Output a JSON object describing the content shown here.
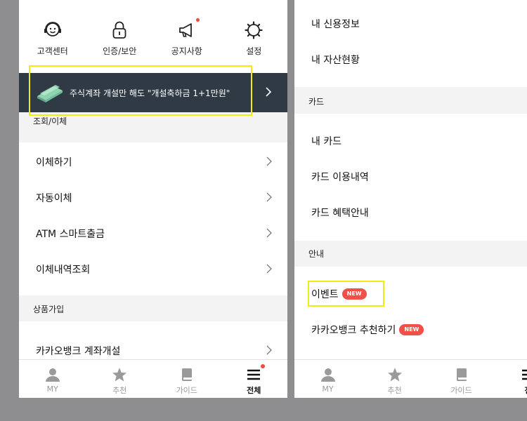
{
  "left_screen": {
    "quick_menu": [
      {
        "label": "고객센터",
        "icon": "headset-icon"
      },
      {
        "label": "인증/보안",
        "icon": "lock-icon"
      },
      {
        "label": "공지사항",
        "icon": "megaphone-icon"
      },
      {
        "label": "설정",
        "icon": "gear-icon"
      }
    ],
    "banner": {
      "text": "주식계좌 개설만 해도 \"개설축하금 1+1만원\"",
      "icon": "money-icon"
    },
    "sections": [
      {
        "title": "조회/이체",
        "items": [
          "이체하기",
          "자동이체",
          "ATM 스마트출금",
          "이체내역조회"
        ]
      },
      {
        "title": "상품가입",
        "items": [
          "카카오뱅크 계좌개설"
        ]
      }
    ],
    "tabs": [
      {
        "label": "MY",
        "icon": "person-icon",
        "active": false
      },
      {
        "label": "추천",
        "icon": "star-icon",
        "active": false
      },
      {
        "label": "가이드",
        "icon": "book-icon",
        "active": false
      },
      {
        "label": "전체",
        "icon": "menu-icon",
        "active": true
      }
    ]
  },
  "right_screen": {
    "top_items": [
      "내 신용정보",
      "내 자산현황"
    ],
    "sections": [
      {
        "title": "카드",
        "items": [
          "내 카드",
          "카드 이용내역",
          "카드 혜택안내"
        ]
      },
      {
        "title": "안내",
        "items": [
          {
            "label": "이벤트",
            "badge": "NEW"
          },
          {
            "label": "카카오뱅크 추천하기",
            "badge": "NEW"
          }
        ]
      }
    ],
    "tabs": [
      {
        "label": "MY",
        "icon": "person-icon"
      },
      {
        "label": "추천",
        "icon": "star-icon"
      },
      {
        "label": "가이드",
        "icon": "book-icon"
      },
      {
        "label": "전",
        "icon": "menu-icon"
      }
    ]
  },
  "colors": {
    "background": "#8e8e90",
    "banner": "#2f3a45",
    "badge": "#f0504a",
    "highlight": "#f5eb14",
    "section_bg": "#f3f3f3"
  }
}
